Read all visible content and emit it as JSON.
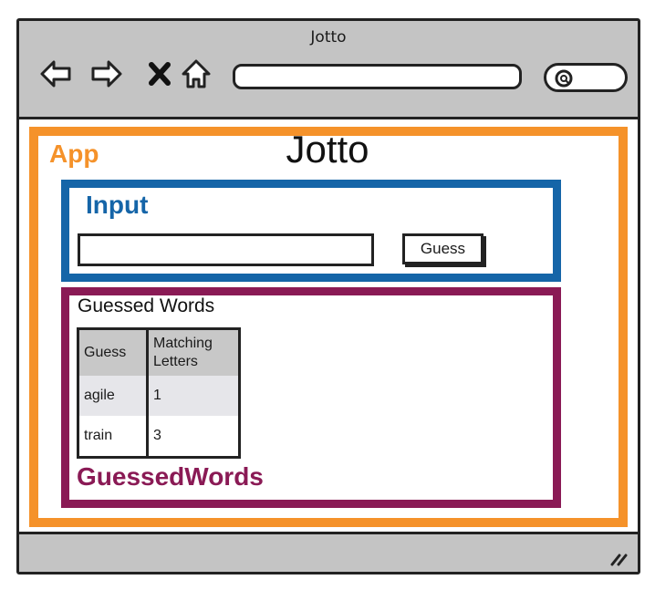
{
  "window": {
    "title": "Jotto"
  },
  "nav_icons": [
    "back-arrow-icon",
    "forward-arrow-icon",
    "close-x-icon",
    "home-icon"
  ],
  "search": {
    "icon": "search-icon"
  },
  "app": {
    "label": "App",
    "title": "Jotto",
    "color": "#f5922a"
  },
  "input": {
    "label": "Input",
    "color": "#1565a8",
    "field_value": "",
    "button_label": "Guess"
  },
  "guessed_words": {
    "label": "GuessedWords",
    "heading": "Guessed Words",
    "color": "#8a1a55",
    "table": {
      "headers": [
        "Guess",
        "Matching Letters"
      ],
      "rows": [
        {
          "guess": "agile",
          "matching": "1"
        },
        {
          "guess": "train",
          "matching": "3"
        }
      ]
    }
  }
}
